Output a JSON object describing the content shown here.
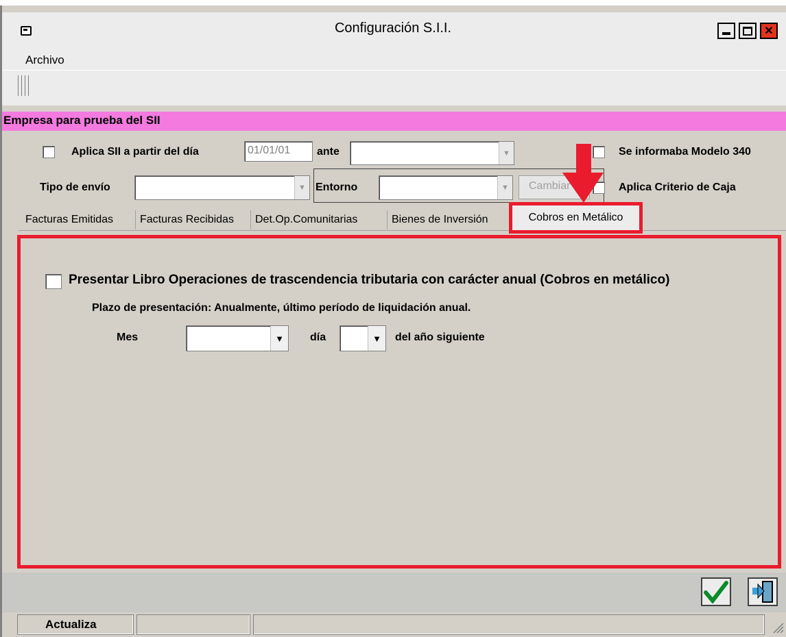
{
  "window": {
    "title": "Configuración S.I.I.",
    "minimize": "‒",
    "maximize": "□",
    "close": "✕"
  },
  "menu": {
    "file": "Archivo"
  },
  "company": {
    "name": "Empresa para prueba del SII"
  },
  "header": {
    "apply_sii_label": "Aplica SII a partir del día",
    "date_value": "01/01/01",
    "ante_label": "ante",
    "modelo340_label": "Se informaba Modelo 340",
    "tipo_envio_label": "Tipo de envío",
    "entorno_label": "Entorno",
    "cambiar_label": "Cambiar",
    "criterio_caja_label": "Aplica Criterio de Caja"
  },
  "tabs": [
    {
      "label": "Facturas Emitidas"
    },
    {
      "label": "Facturas Recibidas"
    },
    {
      "label": "Det.Op.Comunitarias"
    },
    {
      "label": "Bienes de Inversión"
    },
    {
      "label": "Cobros en Metálico"
    }
  ],
  "panel": {
    "presentar_label": "Presentar Libro Operaciones de trascendencia tributaria con carácter anual (Cobros en metálico)",
    "plazo_text": "Plazo de presentación: Anualmente, último período de liquidación anual.",
    "mes_label": "Mes",
    "dia_label": "día",
    "siguiente_label": "del año siguiente"
  },
  "status": {
    "text": "Actualiza"
  },
  "colors": {
    "highlight": "#ea1b2d",
    "company_bar": "#f47ae0"
  }
}
